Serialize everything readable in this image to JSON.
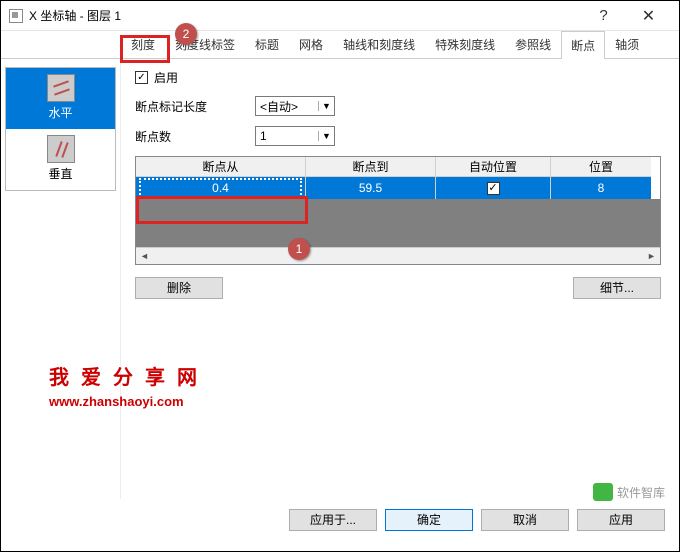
{
  "window": {
    "title": "X 坐标轴 - 图层 1",
    "help": "?",
    "close": "✕"
  },
  "tabs": [
    "刻度",
    "刻度线标签",
    "标题",
    "网格",
    "轴线和刻度线",
    "特殊刻度线",
    "参照线",
    "断点",
    "轴须"
  ],
  "active_tab": "断点",
  "sidebar": {
    "items": [
      {
        "label": "水平"
      },
      {
        "label": "垂直"
      }
    ]
  },
  "enable": {
    "label": "启用",
    "checked": true
  },
  "mark_len": {
    "label": "断点标记长度",
    "value": "<自动>"
  },
  "breaks": {
    "label": "断点数",
    "value": "1"
  },
  "grid": {
    "headers": [
      "断点从",
      "断点到",
      "自动位置",
      "位置"
    ],
    "row": {
      "from": "0.4",
      "to": "59.5",
      "auto": true,
      "pos": "8"
    }
  },
  "buttons": {
    "delete": "删除",
    "detail": "细节...",
    "apply_to": "应用于...",
    "ok": "确定",
    "cancel": "取消",
    "apply": "应用"
  },
  "badges": {
    "b1": "1",
    "b2": "2"
  },
  "watermark": {
    "text": "我爱分享网",
    "url": "www.zhanshaoyi.com"
  },
  "ext": {
    "text": "软件智库"
  }
}
